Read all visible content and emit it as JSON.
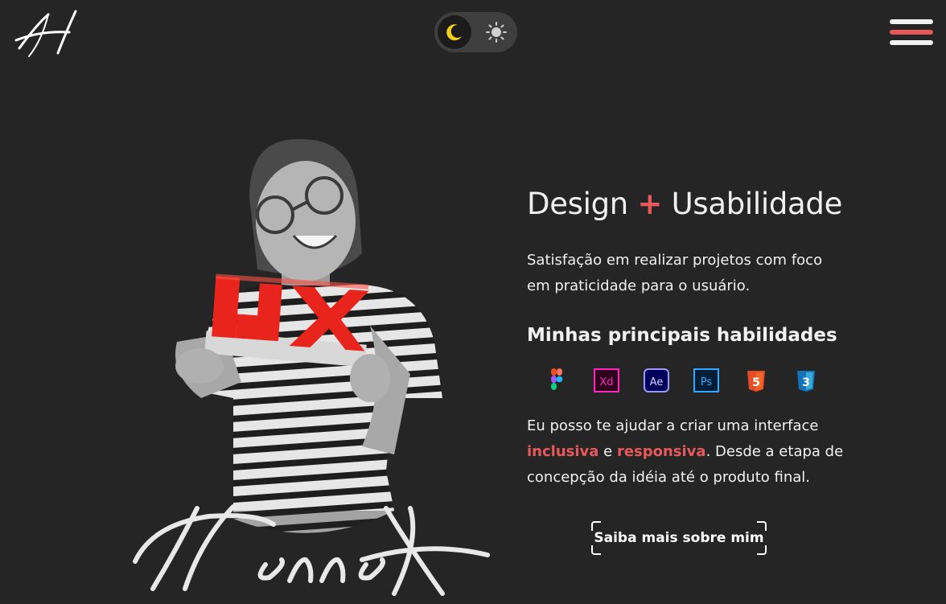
{
  "header": {
    "logo_icon": "hanna-monogram-logo",
    "theme_toggle": {
      "active": "dark",
      "dark_icon": "moon-icon",
      "light_icon": "sun-icon"
    },
    "menu_icon": "hamburger-menu-icon"
  },
  "colors": {
    "background": "#252525",
    "accent": "#e8595c",
    "text": "#f1f1f1",
    "moon": "#f2cf1a"
  },
  "hero": {
    "photo": "grayscale-portrait-holding-red-ux-lego",
    "signature_text": "Hanna"
  },
  "main": {
    "headline_left": "Design",
    "headline_plus": "+",
    "headline_right": "Usabilidade",
    "lead": "Satisfação em realizar projetos com foco em praticidade para o usuário.",
    "skills_title": "Minhas principais habilidades",
    "skills": [
      {
        "name": "figma-icon"
      },
      {
        "name": "adobe-xd-icon",
        "label": "Xd"
      },
      {
        "name": "after-effects-icon",
        "label": "Ae"
      },
      {
        "name": "photoshop-icon",
        "label": "Ps"
      },
      {
        "name": "html5-icon",
        "label": "5"
      },
      {
        "name": "css3-icon",
        "label": "3"
      }
    ],
    "help_part1": "Eu posso te ajudar a criar uma interface ",
    "help_highlight1": "inclusiva",
    "help_part2": " e ",
    "help_highlight2": "responsiva",
    "help_part3": ". Desde a etapa de concepção da idéia até o produto final.",
    "cta_label": "Saiba mais sobre mim"
  }
}
